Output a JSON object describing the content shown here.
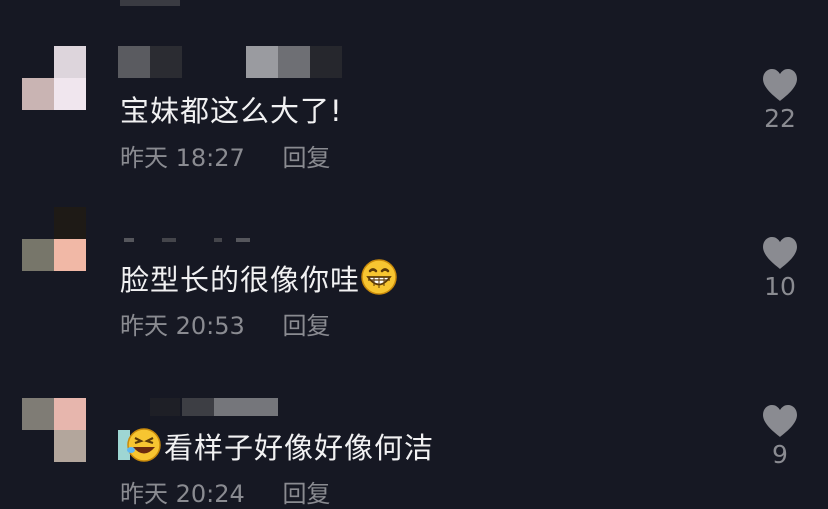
{
  "comments": [
    {
      "content": "宝妹都这么大了!",
      "time": "昨天 18:27",
      "reply_label": "回复",
      "likes": "22",
      "emoji": ""
    },
    {
      "content": "脸型长的很像你哇",
      "time": "昨天 20:53",
      "reply_label": "回复",
      "likes": "10",
      "emoji": "grinning-face-icon"
    },
    {
      "content": "看样子好像好像何洁",
      "time": "昨天 20:24",
      "reply_label": "回复",
      "likes": "9",
      "emoji": "laughing-face-icon"
    }
  ],
  "colors": {
    "background": "#161823",
    "text": "#f1f1f2",
    "muted": "#8a8b91",
    "heart": "#8a8b91"
  }
}
